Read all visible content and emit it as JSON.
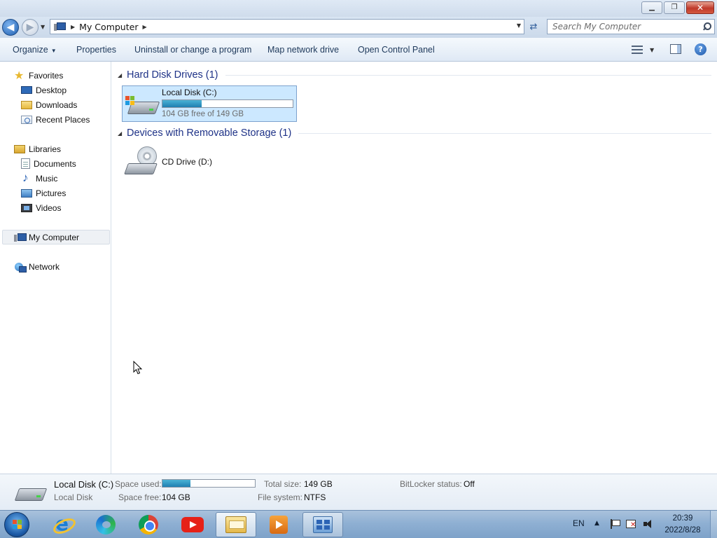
{
  "window": {
    "minimize": "▁",
    "maximize": "❐",
    "close": "✕"
  },
  "address": {
    "location": "My Computer",
    "search_placeholder": "Search My Computer"
  },
  "toolbar": {
    "organize": "Organize",
    "properties": "Properties",
    "uninstall": "Uninstall or change a program",
    "map_drive": "Map network drive",
    "control_panel": "Open Control Panel"
  },
  "nav": {
    "favorites": "Favorites",
    "desktop": "Desktop",
    "downloads": "Downloads",
    "recent_places": "Recent Places",
    "libraries": "Libraries",
    "documents": "Documents",
    "music": "Music",
    "pictures": "Pictures",
    "videos": "Videos",
    "my_computer": "My Computer",
    "network": "Network"
  },
  "content": {
    "hard_disk_group": "Hard Disk Drives (1)",
    "removable_group": "Devices with Removable Storage (1)",
    "local_disk": {
      "name": "Local Disk (C:)",
      "free_text": "104 GB free of 149 GB",
      "used_fraction": 0.3
    },
    "cd_drive": {
      "name": "CD Drive (D:)"
    }
  },
  "details": {
    "title": "Local Disk (C:)",
    "subtitle": "Local Disk",
    "space_used_label": "Space used:",
    "space_free_label": "Space free:",
    "space_free_value": "104 GB",
    "total_size_label": "Total size:",
    "total_size_value": "149 GB",
    "file_system_label": "File system:",
    "file_system_value": "NTFS",
    "bitlocker_label": "BitLocker status:",
    "bitlocker_value": "Off",
    "used_fraction": 0.3
  },
  "taskbar": {
    "apps": [
      "internet-explorer",
      "microsoft-edge",
      "google-chrome",
      "youtube",
      "windows-explorer",
      "media-player",
      "control-panel"
    ],
    "language": "EN",
    "time": "20:39",
    "date": "2022/8/28"
  },
  "colors": {
    "accent": "#1e3287",
    "selection": "#cce8ff",
    "bar_fill": "#1f7fb1"
  }
}
